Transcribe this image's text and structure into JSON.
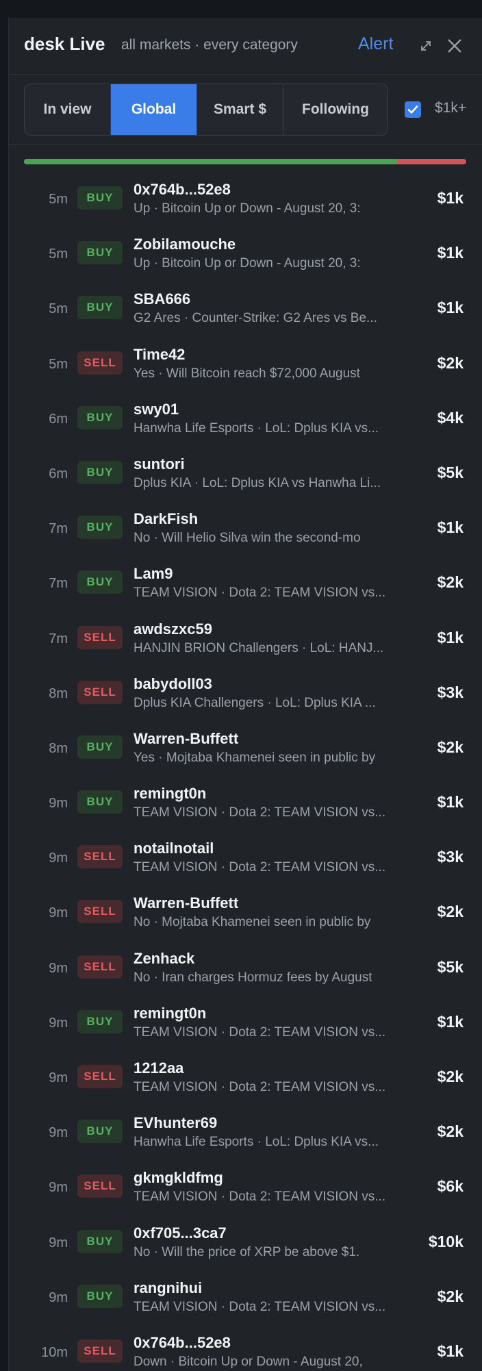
{
  "header": {
    "title": "desk Live",
    "subtitle": "all markets · every category",
    "alert_label": "Alert"
  },
  "tabs": [
    {
      "label": "In view",
      "active": false
    },
    {
      "label": "Global",
      "active": true
    },
    {
      "label": "Smart $",
      "active": false
    },
    {
      "label": "Following",
      "active": false
    }
  ],
  "filter": {
    "checked": true,
    "label": "$1k+"
  },
  "ratio": {
    "buy_fraction": 0.843,
    "buy_color": "#47a64f",
    "sell_color": "#d1555a"
  },
  "trades": [
    {
      "age": "5m",
      "side": "BUY",
      "trader": "0x764b...52e8",
      "market": "Up · Bitcoin Up or Down - August 20, 3:",
      "amount": "$1k"
    },
    {
      "age": "5m",
      "side": "BUY",
      "trader": "Zobilamouche",
      "market": "Up · Bitcoin Up or Down - August 20, 3:",
      "amount": "$1k"
    },
    {
      "age": "5m",
      "side": "BUY",
      "trader": "SBA666",
      "market": "G2 Ares · Counter-Strike: G2 Ares vs Be...",
      "amount": "$1k"
    },
    {
      "age": "5m",
      "side": "SELL",
      "trader": "Time42",
      "market": "Yes · Will Bitcoin reach $72,000 August",
      "amount": "$2k"
    },
    {
      "age": "6m",
      "side": "BUY",
      "trader": "swy01",
      "market": "Hanwha Life Esports · LoL: Dplus KIA vs...",
      "amount": "$4k"
    },
    {
      "age": "6m",
      "side": "BUY",
      "trader": "suntori",
      "market": "Dplus KIA · LoL: Dplus KIA vs Hanwha Li...",
      "amount": "$5k"
    },
    {
      "age": "7m",
      "side": "BUY",
      "trader": "DarkFish",
      "market": "No · Will Helio Silva win the second-mo",
      "amount": "$1k"
    },
    {
      "age": "7m",
      "side": "BUY",
      "trader": "Lam9",
      "market": "TEAM VISION · Dota 2: TEAM VISION vs...",
      "amount": "$2k"
    },
    {
      "age": "7m",
      "side": "SELL",
      "trader": "awdszxc59",
      "market": "HANJIN BRION Challengers · LoL: HANJ...",
      "amount": "$1k"
    },
    {
      "age": "8m",
      "side": "SELL",
      "trader": "babydoll03",
      "market": "Dplus KIA Challengers · LoL: Dplus KIA ...",
      "amount": "$3k"
    },
    {
      "age": "8m",
      "side": "BUY",
      "trader": "Warren-Buffett",
      "market": "Yes · Mojtaba Khamenei seen in public by",
      "amount": "$2k"
    },
    {
      "age": "9m",
      "side": "BUY",
      "trader": "remingt0n",
      "market": "TEAM VISION · Dota 2: TEAM VISION vs...",
      "amount": "$1k"
    },
    {
      "age": "9m",
      "side": "SELL",
      "trader": "notailnotail",
      "market": "TEAM VISION · Dota 2: TEAM VISION vs...",
      "amount": "$3k"
    },
    {
      "age": "9m",
      "side": "SELL",
      "trader": "Warren-Buffett",
      "market": "No · Mojtaba Khamenei seen in public by",
      "amount": "$2k"
    },
    {
      "age": "9m",
      "side": "SELL",
      "trader": "Zenhack",
      "market": "No · Iran charges Hormuz fees by August",
      "amount": "$5k"
    },
    {
      "age": "9m",
      "side": "BUY",
      "trader": "remingt0n",
      "market": "TEAM VISION · Dota 2: TEAM VISION vs...",
      "amount": "$1k"
    },
    {
      "age": "9m",
      "side": "SELL",
      "trader": "1212aa",
      "market": "TEAM VISION · Dota 2: TEAM VISION vs...",
      "amount": "$2k"
    },
    {
      "age": "9m",
      "side": "BUY",
      "trader": "EVhunter69",
      "market": "Hanwha Life Esports · LoL: Dplus KIA vs...",
      "amount": "$2k"
    },
    {
      "age": "9m",
      "side": "SELL",
      "trader": "gkmgkldfmg",
      "market": "TEAM VISION · Dota 2: TEAM VISION vs...",
      "amount": "$6k"
    },
    {
      "age": "9m",
      "side": "BUY",
      "trader": "0xf705...3ca7",
      "market": "No · Will the price of XRP be above $1.",
      "amount": "$10k"
    },
    {
      "age": "9m",
      "side": "BUY",
      "trader": "rangnihui",
      "market": "TEAM VISION · Dota 2: TEAM VISION vs...",
      "amount": "$2k"
    },
    {
      "age": "10m",
      "side": "SELL",
      "trader": "0x764b...52e8",
      "market": "Down · Bitcoin Up or Down - August 20,",
      "amount": "$1k"
    }
  ]
}
